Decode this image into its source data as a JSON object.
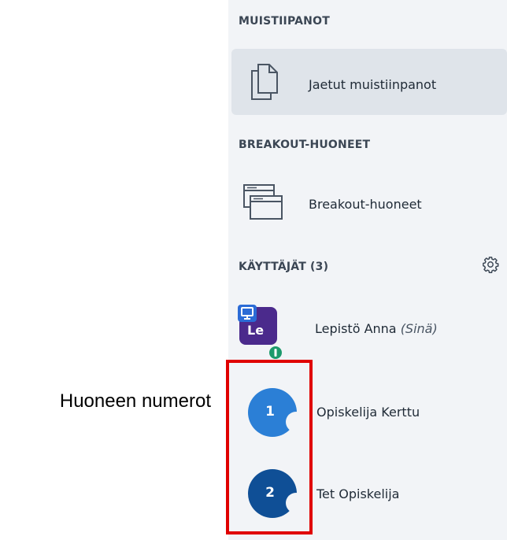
{
  "sidebar": {
    "notes_section": {
      "title": "MUISTIIPANOT",
      "item": {
        "label": "Jaetut muistiinpanot",
        "icon": "documents-icon"
      }
    },
    "breakout_section": {
      "title": "BREAKOUT-HUONEET",
      "item": {
        "label": "Breakout-huoneet",
        "icon": "windows-icon"
      }
    },
    "users_section": {
      "title": "KÄYTTÄJÄT (3)",
      "settings_icon": "gear-icon",
      "users": [
        {
          "initials": "Le",
          "name": "Lepistö Anna",
          "suffix": "(Sinä)",
          "avatar_color": "#4b2a8c"
        },
        {
          "room_number": "1",
          "name": "Opiskelija Kerttu",
          "avatar_color": "#2b7fd6"
        },
        {
          "room_number": "2",
          "name": "Tet Opiskelija",
          "avatar_color": "#0f4f96"
        }
      ]
    }
  },
  "annotation": {
    "label": "Huoneen numerot",
    "highlight_color": "#e00000"
  }
}
